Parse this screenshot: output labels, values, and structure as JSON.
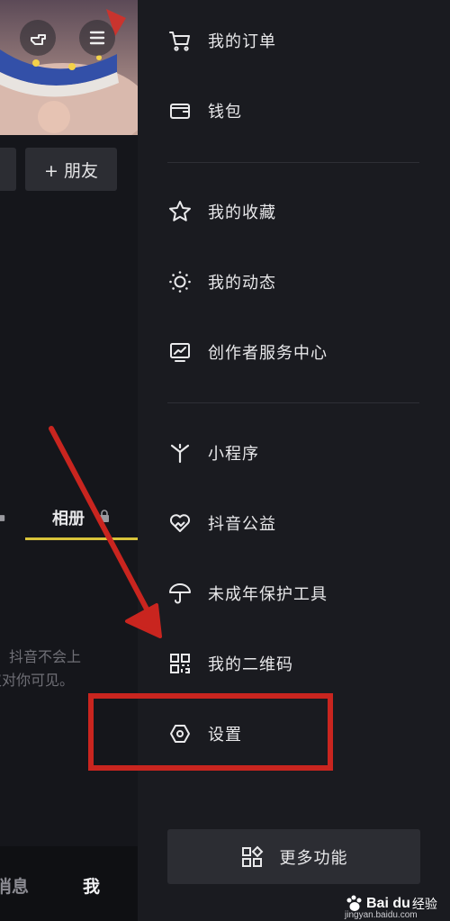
{
  "profile": {
    "add_friend_label": "+ 朋友",
    "album_tab_label": "相册",
    "privacy_hint_line1": "抖音不会上",
    "privacy_hint_line2": "仅对你可见。",
    "bottom_nav": {
      "message": "消息",
      "me": "我"
    }
  },
  "drawer": {
    "items": [
      {
        "label": "我的订单",
        "icon": "cart-icon"
      },
      {
        "label": "钱包",
        "icon": "wallet-icon"
      },
      {
        "label": "我的收藏",
        "icon": "star-icon"
      },
      {
        "label": "我的动态",
        "icon": "sun-dotted-icon"
      },
      {
        "label": "创作者服务中心",
        "icon": "monitor-chart-icon"
      },
      {
        "label": "小程序",
        "icon": "asterisk-icon"
      },
      {
        "label": "抖音公益",
        "icon": "heart-icon"
      },
      {
        "label": "未成年保护工具",
        "icon": "umbrella-icon"
      },
      {
        "label": "我的二维码",
        "icon": "qr-code-icon"
      },
      {
        "label": "设置",
        "icon": "hexagon-settings-icon"
      }
    ],
    "more_button_label": "更多功能"
  },
  "watermark": {
    "brand": "Bai du",
    "jingyan": "经验",
    "url": "jingyan.baidu.com"
  },
  "colors": {
    "drawer_bg": "#1a1b20",
    "highlight_red": "#c9251f",
    "tab_underline": "#d8c33a"
  }
}
